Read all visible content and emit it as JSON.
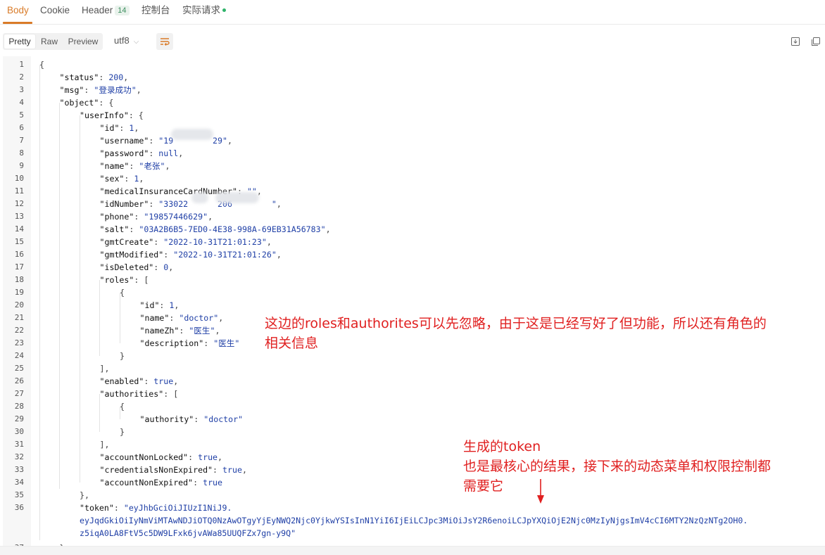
{
  "tabs": [
    {
      "label": "Body"
    },
    {
      "label": "Cookie"
    },
    {
      "label": "Header",
      "badge": "14"
    },
    {
      "label": "控制台"
    },
    {
      "label": "实际请求"
    }
  ],
  "toolbar": {
    "view_modes": [
      "Pretty",
      "Raw",
      "Preview"
    ],
    "encoding": "utf8"
  },
  "code_lines": [
    {
      "n": "1",
      "indent": 0,
      "text": "{"
    },
    {
      "n": "2",
      "indent": 1,
      "key": "\"status\"",
      "sep": ": ",
      "val": "200",
      "vt": "n",
      "end": ","
    },
    {
      "n": "3",
      "indent": 1,
      "key": "\"msg\"",
      "sep": ": ",
      "val": "\"登录成功\"",
      "vt": "s",
      "end": ","
    },
    {
      "n": "4",
      "indent": 1,
      "key": "\"object\"",
      "sep": ": ",
      "end": "{"
    },
    {
      "n": "5",
      "indent": 2,
      "key": "\"userInfo\"",
      "sep": ": ",
      "end": "{"
    },
    {
      "n": "6",
      "indent": 3,
      "key": "\"id\"",
      "sep": ": ",
      "val": "1",
      "vt": "n",
      "end": ","
    },
    {
      "n": "7",
      "indent": 3,
      "key": "\"username\"",
      "sep": ": ",
      "val": "\"19        29\"",
      "vt": "s",
      "end": ","
    },
    {
      "n": "8",
      "indent": 3,
      "key": "\"password\"",
      "sep": ": ",
      "val": "null",
      "vt": "n",
      "end": ","
    },
    {
      "n": "9",
      "indent": 3,
      "key": "\"name\"",
      "sep": ": ",
      "val": "\"老张\"",
      "vt": "s",
      "end": ","
    },
    {
      "n": "10",
      "indent": 3,
      "key": "\"sex\"",
      "sep": ": ",
      "val": "1",
      "vt": "n",
      "end": ","
    },
    {
      "n": "11",
      "indent": 3,
      "key": "\"medicalInsuranceCardNumber\"",
      "sep": ": ",
      "val": "\"\"",
      "vt": "s",
      "end": ","
    },
    {
      "n": "12",
      "indent": 3,
      "key": "\"idNumber\"",
      "sep": ": ",
      "val": "\"33022      206        \"",
      "vt": "s",
      "end": ","
    },
    {
      "n": "13",
      "indent": 3,
      "key": "\"phone\"",
      "sep": ": ",
      "val": "\"19857446629\"",
      "vt": "s",
      "end": ","
    },
    {
      "n": "14",
      "indent": 3,
      "key": "\"salt\"",
      "sep": ": ",
      "val": "\"03A2B6B5-7ED0-4E38-998A-69EB31A56783\"",
      "vt": "s",
      "end": ","
    },
    {
      "n": "15",
      "indent": 3,
      "key": "\"gmtCreate\"",
      "sep": ": ",
      "val": "\"2022-10-31T21:01:23\"",
      "vt": "s",
      "end": ","
    },
    {
      "n": "16",
      "indent": 3,
      "key": "\"gmtModified\"",
      "sep": ": ",
      "val": "\"2022-10-31T21:01:26\"",
      "vt": "s",
      "end": ","
    },
    {
      "n": "17",
      "indent": 3,
      "key": "\"isDeleted\"",
      "sep": ": ",
      "val": "0",
      "vt": "n",
      "end": ","
    },
    {
      "n": "18",
      "indent": 3,
      "key": "\"roles\"",
      "sep": ": ",
      "end": "["
    },
    {
      "n": "19",
      "indent": 4,
      "text": "{"
    },
    {
      "n": "20",
      "indent": 5,
      "key": "\"id\"",
      "sep": ": ",
      "val": "1",
      "vt": "n",
      "end": ","
    },
    {
      "n": "21",
      "indent": 5,
      "key": "\"name\"",
      "sep": ": ",
      "val": "\"doctor\"",
      "vt": "s",
      "end": ","
    },
    {
      "n": "22",
      "indent": 5,
      "key": "\"nameZh\"",
      "sep": ": ",
      "val": "\"医生\"",
      "vt": "s",
      "end": ","
    },
    {
      "n": "23",
      "indent": 5,
      "key": "\"description\"",
      "sep": ": ",
      "val": "\"医生\"",
      "vt": "s"
    },
    {
      "n": "24",
      "indent": 4,
      "text": "}"
    },
    {
      "n": "25",
      "indent": 3,
      "text": "],"
    },
    {
      "n": "26",
      "indent": 3,
      "key": "\"enabled\"",
      "sep": ": ",
      "val": "true",
      "vt": "n",
      "end": ","
    },
    {
      "n": "27",
      "indent": 3,
      "key": "\"authorities\"",
      "sep": ": ",
      "end": "["
    },
    {
      "n": "28",
      "indent": 4,
      "text": "{"
    },
    {
      "n": "29",
      "indent": 5,
      "key": "\"authority\"",
      "sep": ": ",
      "val": "\"doctor\"",
      "vt": "s"
    },
    {
      "n": "30",
      "indent": 4,
      "text": "}"
    },
    {
      "n": "31",
      "indent": 3,
      "text": "],"
    },
    {
      "n": "32",
      "indent": 3,
      "key": "\"accountNonLocked\"",
      "sep": ": ",
      "val": "true",
      "vt": "n",
      "end": ","
    },
    {
      "n": "33",
      "indent": 3,
      "key": "\"credentialsNonExpired\"",
      "sep": ": ",
      "val": "true",
      "vt": "n",
      "end": ","
    },
    {
      "n": "34",
      "indent": 3,
      "key": "\"accountNonExpired\"",
      "sep": ": ",
      "val": "true",
      "vt": "n"
    },
    {
      "n": "35",
      "indent": 2,
      "text": "},"
    },
    {
      "n": "36",
      "indent": 2,
      "key": "\"token\"",
      "sep": ": ",
      "val": "\"eyJhbGciOiJIUzI1NiJ9.",
      "vt": "s"
    },
    {
      "n": "",
      "indent": 2,
      "val": "eyJqdGkiOiIyNmViMTAwNDJiOTQ0NzAwOTgyYjEyNWQ2Njc0YjkwYSIsInN1YiI6IjEiLCJpc3MiOiJsY2R6enoiLCJpYXQiOjE2Njc0MzIyNjgsImV4cCI6MTY2NzQzNTg2OH0.",
      "vt": "s"
    },
    {
      "n": "",
      "indent": 2,
      "val": "z5iqA0LA8FtV5c5DW9LFxk6jvAWa85UUQFZx7gn-y9Q\"",
      "vt": "s"
    },
    {
      "n": "37",
      "indent": 1,
      "text": "}"
    }
  ],
  "annotations": {
    "roles_note_line1": "这边的roles和authorites可以先忽略，由于这是已经写好了但功能，所以还有角色的",
    "roles_note_line2": "相关信息",
    "token_note_line1": "生成的token",
    "token_note_line2": "也是最核心的结果，接下来的动态菜单和权限控制都",
    "token_note_line3": "需要它"
  },
  "colors": {
    "active_tab": "#d97b28",
    "annotation": "#e02020",
    "string_value": "#1f3fa6"
  }
}
